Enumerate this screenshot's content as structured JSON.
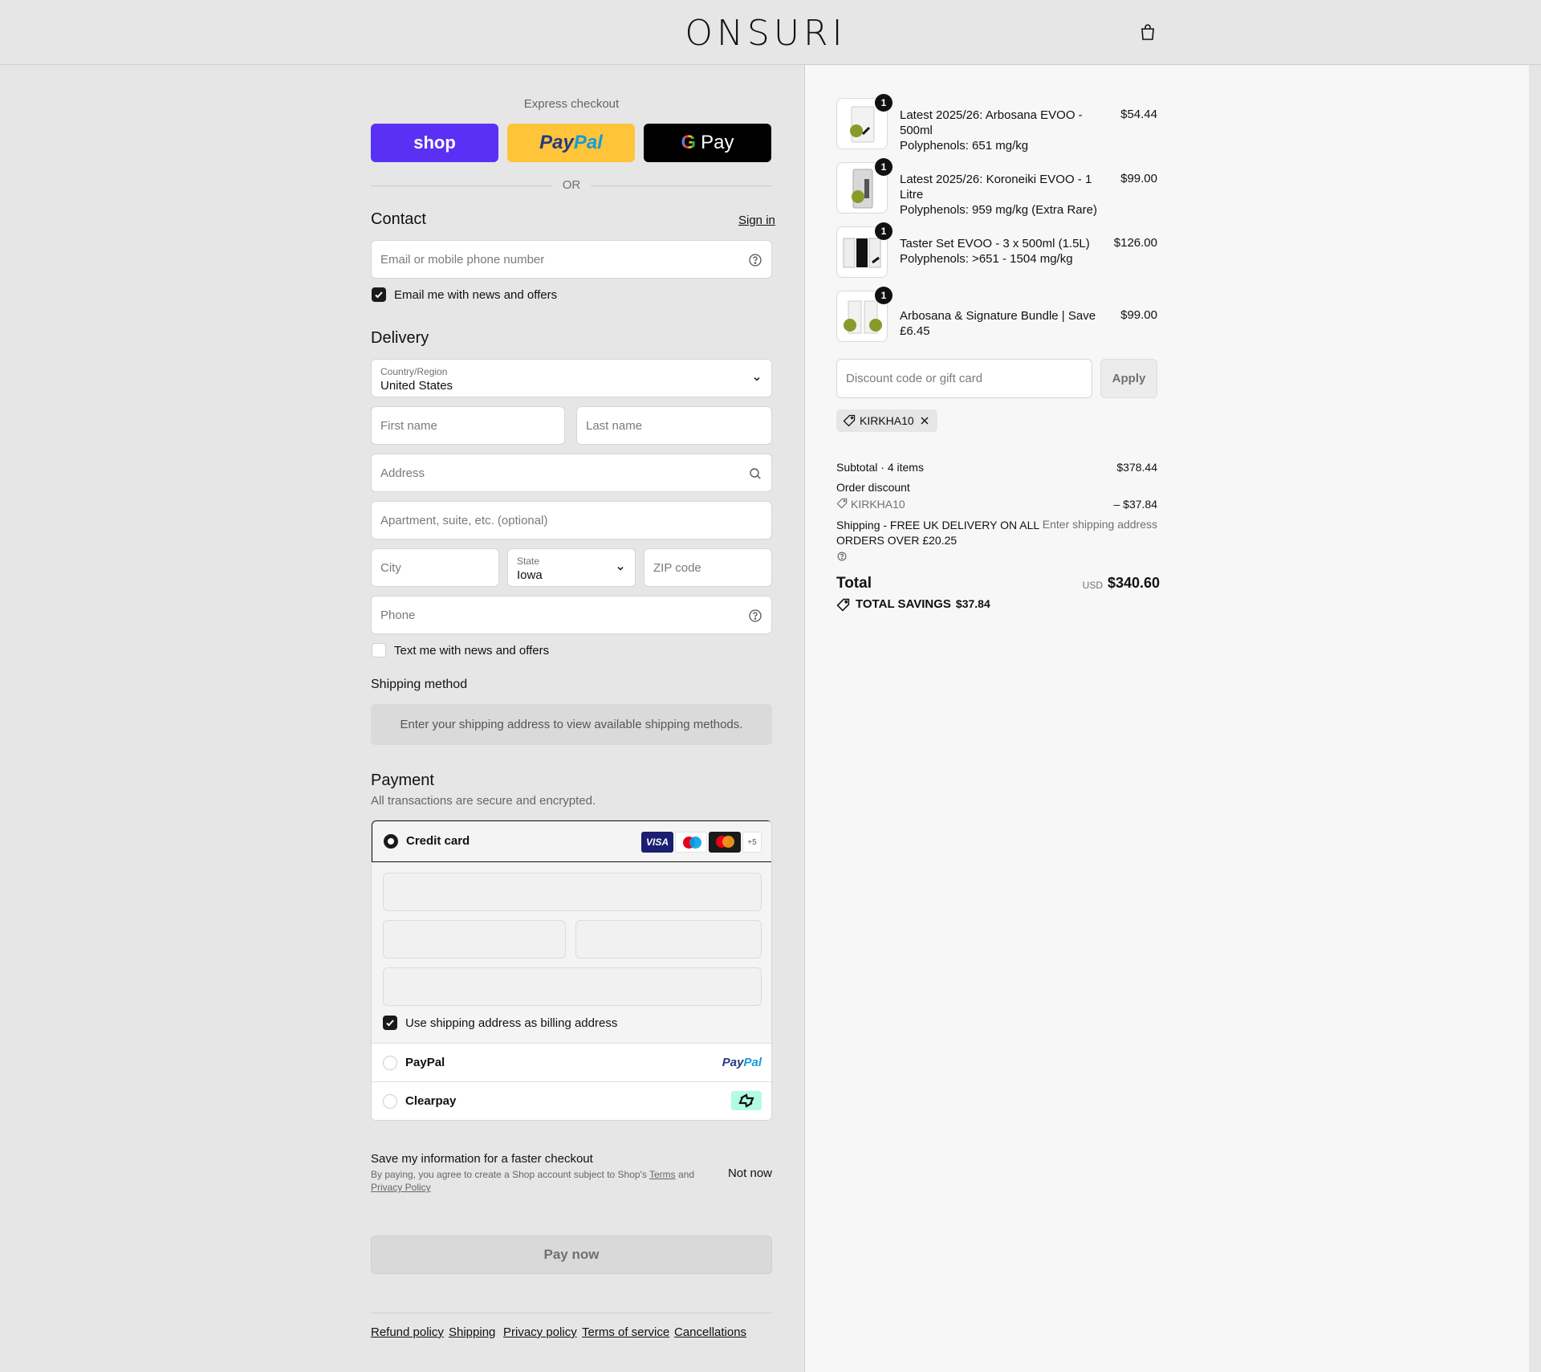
{
  "brand": {
    "logo": "ONSURI"
  },
  "express": {
    "label": "Express checkout",
    "shop": "shop",
    "paypal_a": "Pay",
    "paypal_b": "Pal",
    "gpay_g": "G",
    "gpay": "Pay",
    "or": "OR"
  },
  "contact": {
    "title": "Contact",
    "sign_in": "Sign in",
    "email_placeholder": "Email or mobile phone number",
    "news_label": "Email me with news and offers"
  },
  "delivery": {
    "title": "Delivery",
    "country_label": "Country/Region",
    "country_value": "United States",
    "first_name": "First name",
    "last_name": "Last name",
    "address": "Address",
    "apartment": "Apartment, suite, etc. (optional)",
    "city": "City",
    "state_label": "State",
    "state_value": "Iowa",
    "zip": "ZIP code",
    "phone": "Phone",
    "text_label": "Text me with news and offers"
  },
  "shipping_method": {
    "title": "Shipping method",
    "info": "Enter your shipping address to view available shipping methods."
  },
  "payment": {
    "title": "Payment",
    "subtitle": "All transactions are secure and encrypted.",
    "credit_card": "Credit card",
    "visa": "VISA",
    "more_cards": "+5",
    "billing_label": "Use shipping address as billing address",
    "paypal": "PayPal",
    "paypal_logo_a": "Pay",
    "paypal_logo_b": "Pal",
    "clearpay": "Clearpay"
  },
  "save_info": {
    "title": "Save my information for a faster checkout",
    "text_a": "By paying, you agree to create a Shop account subject to Shop's",
    "terms": "Terms",
    "and": "and",
    "privacy": "Privacy Policy",
    "not_now": "Not now"
  },
  "pay_now": "Pay now",
  "footer": [
    "Refund policy",
    "Shipping",
    "Privacy policy",
    "Terms of service",
    "Cancellations"
  ],
  "items": [
    {
      "qty": "1",
      "name_1": "Latest 2025/26: Arbosana EVOO - 500ml",
      "name_2": "Polyphenols: 651 mg/kg",
      "price": "$54.44"
    },
    {
      "qty": "1",
      "name_1": "Latest 2025/26: Koroneiki EVOO - 1 Litre",
      "name_2": "Polyphenols: 959 mg/kg (Extra Rare)",
      "price": "$99.00"
    },
    {
      "qty": "1",
      "name_1": "Taster Set EVOO - 3 x 500ml (1.5L)",
      "name_2": "Polyphenols: >651 - 1504 mg/kg",
      "price": "$126.00"
    },
    {
      "qty": "1",
      "name_1": "Arbosana & Signature Bundle | Save £6.45",
      "name_2": "",
      "price": "$99.00"
    }
  ],
  "discount": {
    "placeholder": "Discount code or gift card",
    "apply": "Apply",
    "code": "KIRKHA10"
  },
  "summary": {
    "subtotal_label": "Subtotal · 4 items",
    "subtotal": "$378.44",
    "order_discount": "Order discount",
    "discount_code": "KIRKHA10",
    "discount_value": "– $37.84",
    "shipping_label_1": "Shipping - FREE UK DELIVERY ON ALL",
    "shipping_label_2": "ORDERS OVER £20.25",
    "shipping_value": "Enter shipping address",
    "total_label": "Total",
    "currency": "USD",
    "total": "$340.60",
    "savings_label": "TOTAL SAVINGS",
    "savings_value": "$37.84"
  }
}
